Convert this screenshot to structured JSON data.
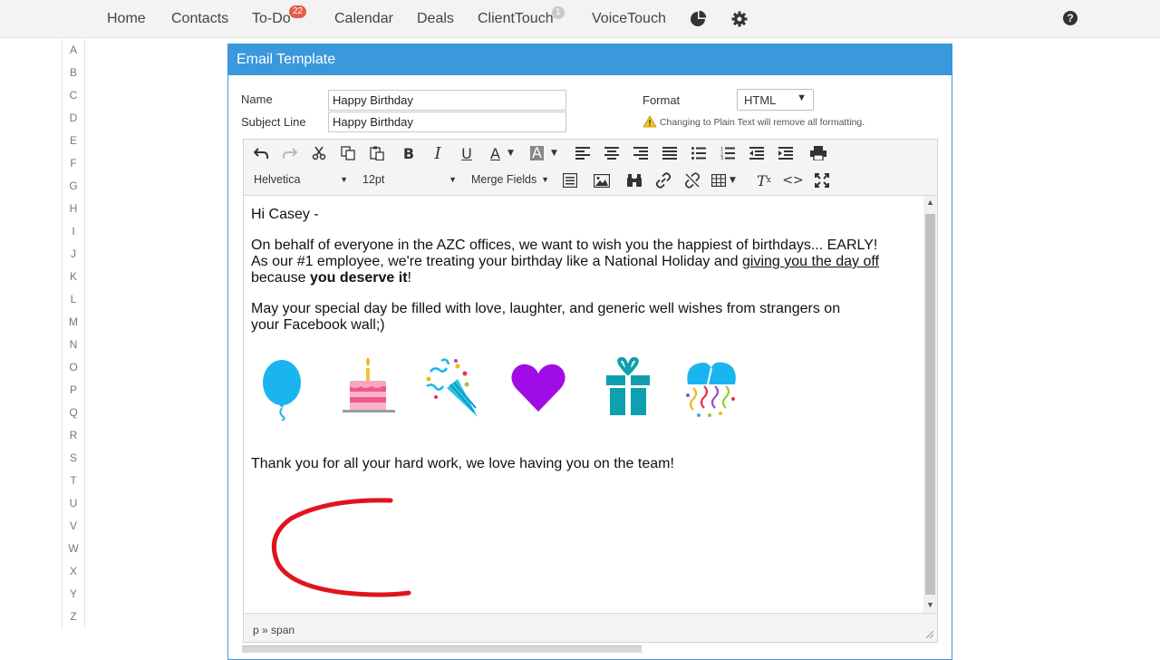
{
  "nav": {
    "items": [
      {
        "label": "Home"
      },
      {
        "label": "Contacts"
      },
      {
        "label": "To-Do",
        "badge": "22"
      },
      {
        "label": "Calendar"
      },
      {
        "label": "Deals"
      },
      {
        "label": "ClientTouch",
        "badge": "1"
      },
      {
        "label": "VoiceTouch"
      }
    ],
    "icons": [
      "pie-chart-icon",
      "gear-icon",
      "help-icon"
    ]
  },
  "alphabet": [
    "A",
    "B",
    "C",
    "D",
    "E",
    "F",
    "G",
    "H",
    "I",
    "J",
    "K",
    "L",
    "M",
    "N",
    "O",
    "P",
    "Q",
    "R",
    "S",
    "T",
    "U",
    "V",
    "W",
    "X",
    "Y",
    "Z"
  ],
  "panel": {
    "title": "Email Template",
    "name_label": "Name",
    "name_value": "Happy Birthday",
    "subject_label": "Subject Line",
    "subject_value": "Happy Birthday",
    "format_label": "Format",
    "format_value": "HTML",
    "format_warning": "Changing to Plain Text will remove all formatting."
  },
  "toolbar": {
    "font_family": "Helvetica",
    "font_size": "12pt",
    "merge_fields": "Merge Fields"
  },
  "email": {
    "greeting": "Hi Casey -",
    "para1_line1": "On behalf of everyone in the AZC offices, we want to wish you the happiest of birthdays... EARLY!",
    "para1_line2_pre": "As our #1 employee, we're treating your birthday like a National Holiday and ",
    "para1_line2_link": "giving you the day off",
    "para1_line3_pre": "because ",
    "para1_line3_bold": "you deserve it",
    "para1_line3_post": "!",
    "para2_line1": "May your special day be filled with love, laughter, and generic well wishes from strangers on",
    "para2_line2": "your Facebook wall;)",
    "closing": "Thank you for all your hard work, we love having you on the team!",
    "emojis": [
      "balloon-icon",
      "birthday-cake-icon",
      "party-popper-icon",
      "heart-icon",
      "gift-icon",
      "confetti-balloon-icon"
    ]
  },
  "statusbar": {
    "path": "p » span"
  },
  "colors": {
    "accent": "#3a98dc",
    "annotation_red": "#e0141e"
  }
}
